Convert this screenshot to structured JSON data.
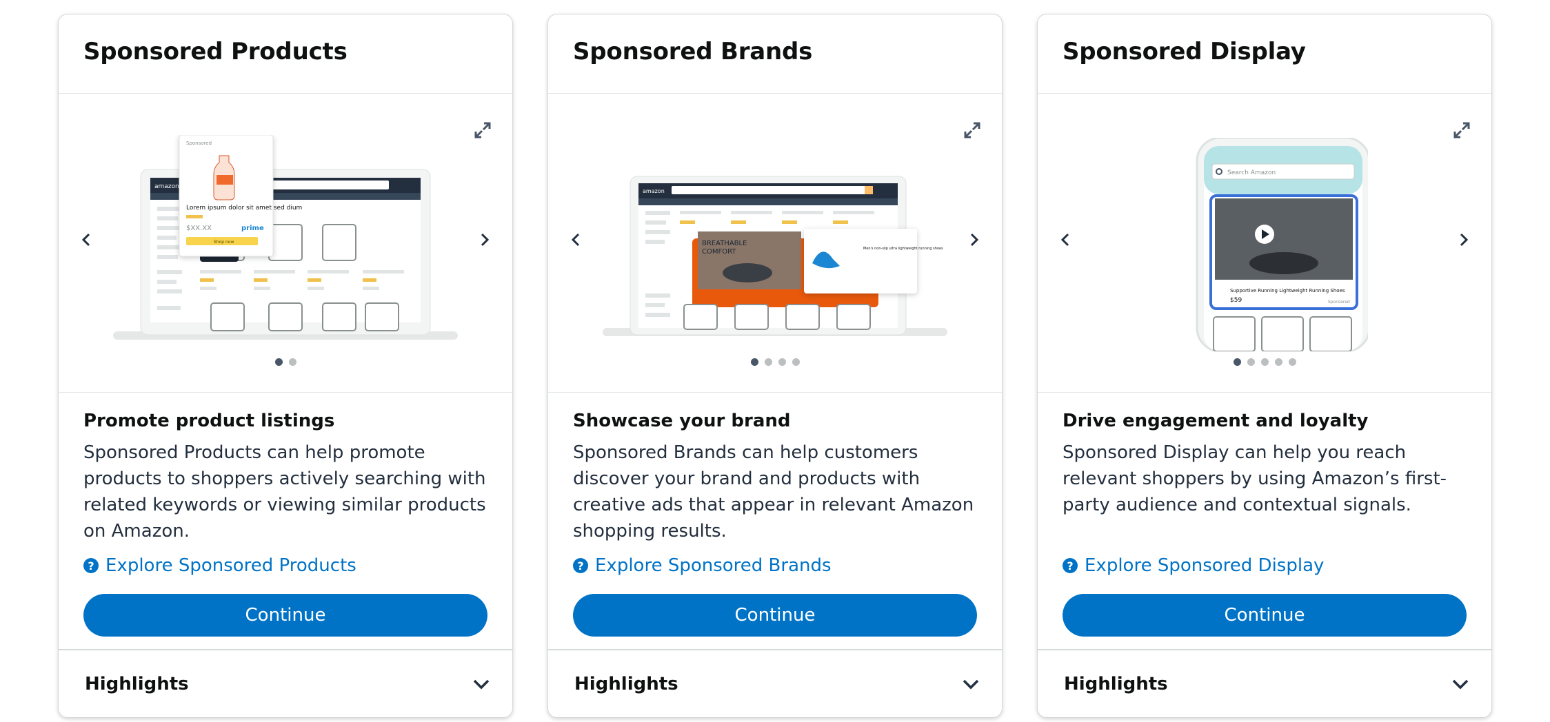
{
  "cards": [
    {
      "title": "Sponsored Products",
      "subtitle": "Promote product listings",
      "description": "Sponsored Products can help promote products to shoppers actively searching with related keywords or viewing similar products on Amazon.",
      "explore_label": "Explore Sponsored Products",
      "continue_label": "Continue",
      "highlights_label": "Highlights",
      "carousel_slides": 2,
      "active_slide": 1,
      "illustration": {
        "popup_label": "Sponsored",
        "popup_text": "Lorem ipsum dolor sit amet sed dium",
        "price": "$XX.XX",
        "prime": "prime",
        "shop_now": "Shop now"
      }
    },
    {
      "title": "Sponsored Brands",
      "subtitle": "Showcase your brand",
      "description": "Sponsored Brands can help customers discover your brand and products with creative ads that appear in relevant Amazon shopping results.",
      "explore_label": "Explore Sponsored Brands",
      "continue_label": "Continue",
      "highlights_label": "Highlights",
      "carousel_slides": 4,
      "active_slide": 1,
      "illustration": {
        "banner_text_1": "BREATHABLE",
        "banner_text_2": "COMFORT",
        "product_text": "Men's non-slip ultra lightweight running shoes"
      }
    },
    {
      "title": "Sponsored Display",
      "subtitle": "Drive engagement and loyalty",
      "description": "Sponsored Display can help you reach relevant shoppers by using Amazon’s first-party audience and contextual signals.",
      "explore_label": "Explore Sponsored Display",
      "continue_label": "Continue",
      "highlights_label": "Highlights",
      "carousel_slides": 5,
      "active_slide": 1,
      "illustration": {
        "search_placeholder": "Search Amazon",
        "product_title": "Supportive Running Lightweight Running Shoes",
        "price": "$59",
        "sponsored": "Sponsored"
      }
    }
  ],
  "colors": {
    "accent": "#0073c7",
    "text": "#0f1111",
    "border": "#d5d9d9",
    "dot_active": "#485668",
    "dot_inactive": "#bbbfbf",
    "amazon_nav": "#232f3e",
    "brand_orange": "#e8590c"
  }
}
